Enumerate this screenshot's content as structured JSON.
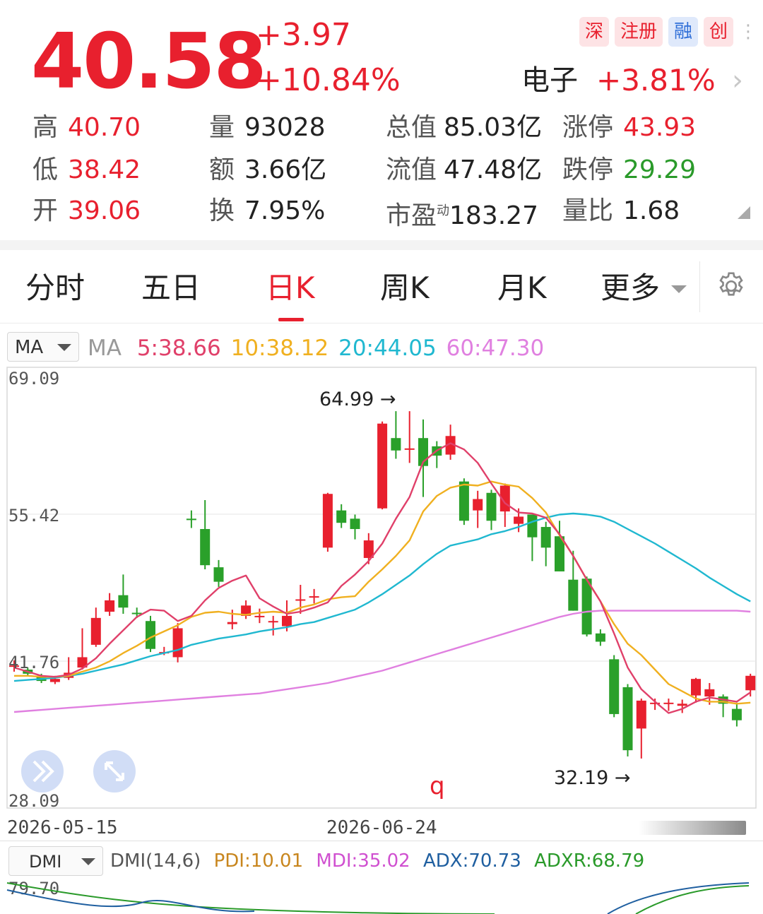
{
  "quote": {
    "price": "40.58",
    "change": "+3.97",
    "change_pct": "+10.84%",
    "badges": [
      {
        "label": "深",
        "style": "red"
      },
      {
        "label": "注册",
        "style": "red"
      },
      {
        "label": "融",
        "style": "blue"
      },
      {
        "label": "创",
        "style": "red"
      }
    ],
    "sector_name": "电子",
    "sector_change": "+3.81%",
    "stats": {
      "high": {
        "label": "高",
        "value": "40.70"
      },
      "low": {
        "label": "低",
        "value": "38.42"
      },
      "open": {
        "label": "开",
        "value": "39.06"
      },
      "volume": {
        "label": "量",
        "value": "93028"
      },
      "amount": {
        "label": "额",
        "value": "3.66亿"
      },
      "turnover": {
        "label": "换",
        "value": "7.95%"
      },
      "total_cap": {
        "label": "总值",
        "value": "85.03亿"
      },
      "float_cap": {
        "label": "流值",
        "value": "47.48亿"
      },
      "pe": {
        "label": "市盈",
        "sup": "动",
        "value": "183.27"
      },
      "limit_up": {
        "label": "涨停",
        "value": "43.93"
      },
      "limit_down": {
        "label": "跌停",
        "value": "29.29"
      },
      "volume_ratio": {
        "label": "量比",
        "value": "1.68"
      }
    }
  },
  "tabs": {
    "items": [
      "分时",
      "五日",
      "日K",
      "周K",
      "月K",
      "更多"
    ],
    "active": "日K"
  },
  "ma_legend": {
    "selector": "MA",
    "title": "MA",
    "ma5": "5:38.66",
    "ma10": "10:38.12",
    "ma20": "20:44.05",
    "ma60": "60:47.30",
    "colors": {
      "ma5": "#e0406a",
      "ma10": "#f0b020",
      "ma20": "#20b8d0",
      "ma60": "#e080e0",
      "up": "#e8202e",
      "down": "#2aa02a"
    }
  },
  "kline": {
    "y_max_label": "69.09",
    "y_mid_label": "55.42",
    "y_low_label": "41.76",
    "y_min_label": "28.09",
    "high_marker": "64.99 →",
    "low_marker": "32.19 →",
    "mark_q": "q",
    "date_left": "2026-05-15",
    "date_mid": "2026-06-24"
  },
  "chart_data": {
    "type": "candlestick",
    "y_range": [
      28.09,
      69.09
    ],
    "y_ticks": [
      69.09,
      55.42,
      41.76,
      28.09
    ],
    "x_labels": [
      {
        "index": 0,
        "label": "2026-05-15"
      },
      {
        "index": 26,
        "label": "2026-06-24"
      }
    ],
    "annotations": [
      {
        "text": "64.99 →",
        "value": 64.99
      },
      {
        "text": "32.19 →",
        "value": 32.19
      }
    ],
    "candles": [
      [
        41.1,
        41.2,
        40.6,
        41.7
      ],
      [
        40.8,
        40.4,
        40.2,
        41.0
      ],
      [
        40.2,
        39.7,
        39.5,
        40.4
      ],
      [
        39.6,
        39.9,
        39.4,
        40.2
      ],
      [
        40.0,
        40.5,
        39.8,
        42.0
      ],
      [
        41.0,
        42.0,
        40.8,
        44.8
      ],
      [
        43.2,
        45.8,
        43.0,
        46.8
      ],
      [
        46.4,
        47.5,
        46.0,
        48.2
      ],
      [
        48.0,
        46.8,
        46.2,
        50.0
      ],
      [
        46.3,
        46.2,
        45.8,
        46.8
      ],
      [
        45.5,
        42.8,
        42.5,
        46.0
      ],
      [
        42.5,
        42.5,
        42.2,
        43.0
      ],
      [
        42.0,
        44.8,
        41.5,
        45.3
      ],
      [
        55.4,
        55.3,
        54.5,
        56.2
      ],
      [
        54.4,
        50.9,
        50.5,
        57.2
      ],
      [
        50.7,
        49.3,
        48.8,
        51.4
      ],
      [
        45.2,
        45.4,
        44.7,
        46.6
      ],
      [
        46.0,
        47.0,
        45.7,
        47.5
      ],
      [
        46.0,
        46.0,
        45.3,
        46.7
      ],
      [
        45.4,
        45.5,
        44.1,
        46.0
      ],
      [
        45.0,
        46.0,
        44.5,
        47.5
      ],
      [
        47.5,
        47.6,
        46.2,
        49.0
      ],
      [
        47.8,
        47.9,
        47.2,
        48.6
      ],
      [
        52.6,
        57.8,
        52.2,
        57.9
      ],
      [
        56.2,
        55.0,
        54.5,
        56.8
      ],
      [
        55.4,
        54.4,
        53.4,
        55.8
      ],
      [
        51.6,
        53.3,
        51.0,
        54.0
      ],
      [
        56.4,
        64.6,
        56.3,
        64.8
      ],
      [
        63.2,
        62.0,
        61.2,
        65.8
      ],
      [
        62.1,
        62.2,
        60.8,
        65.8
      ],
      [
        63.2,
        60.5,
        57.5,
        65.0
      ],
      [
        62.4,
        61.5,
        60.3,
        62.9
      ],
      [
        61.6,
        63.4,
        61.1,
        64.5
      ],
      [
        59.0,
        55.2,
        54.8,
        59.3
      ],
      [
        56.2,
        57.3,
        54.5,
        58.1
      ],
      [
        57.9,
        55.2,
        54.3,
        58.2
      ],
      [
        56.1,
        58.6,
        54.6,
        58.8
      ],
      [
        54.9,
        55.6,
        54.1,
        56.4
      ],
      [
        55.8,
        53.6,
        51.3,
        55.8
      ],
      [
        54.6,
        52.6,
        50.8,
        55.1
      ],
      [
        53.7,
        50.3,
        50.3,
        55.2
      ],
      [
        49.5,
        46.5,
        46.5,
        52.3
      ],
      [
        49.6,
        44.2,
        44.0,
        49.8
      ],
      [
        44.3,
        43.5,
        43.1,
        44.7
      ],
      [
        41.8,
        36.5,
        36.2,
        42.2
      ],
      [
        39.1,
        33.0,
        32.4,
        39.4
      ],
      [
        35.1,
        37.8,
        32.2,
        38.0
      ],
      [
        37.5,
        37.6,
        36.9,
        38.0
      ],
      [
        37.5,
        37.6,
        36.8,
        38.0
      ],
      [
        37.3,
        37.5,
        36.6,
        37.9
      ],
      [
        38.3,
        39.9,
        37.6,
        40.0
      ],
      [
        38.2,
        38.9,
        37.4,
        39.5
      ],
      [
        38.2,
        37.5,
        36.2,
        38.4
      ],
      [
        37.0,
        35.9,
        35.3,
        37.6
      ],
      [
        38.8,
        40.2,
        38.2,
        40.4
      ]
    ],
    "ma5": [
      41.0,
      40.6,
      40.2,
      40.1,
      40.3,
      40.9,
      41.9,
      43.3,
      44.6,
      45.9,
      46.6,
      46.5,
      45.5,
      46.0,
      47.5,
      48.7,
      49.4,
      49.9,
      47.7,
      46.9,
      46.2,
      46.4,
      46.8,
      47.3,
      48.9,
      50.0,
      51.3,
      53.0,
      55.4,
      57.5,
      60.9,
      62.0,
      62.7,
      62.1,
      60.8,
      58.8,
      56.9,
      56.0,
      55.9,
      55.5,
      53.9,
      51.8,
      49.5,
      47.4,
      44.3,
      41.0,
      38.9,
      37.7,
      36.6,
      37.0,
      37.7,
      38.1,
      37.9,
      37.7,
      38.6
    ],
    "ma10": [
      40.2,
      40.2,
      40.1,
      40.1,
      40.2,
      40.6,
      41.0,
      41.6,
      42.4,
      43.1,
      43.9,
      44.5,
      45.1,
      45.9,
      46.3,
      46.4,
      46.2,
      46.1,
      46.3,
      46.4,
      46.3,
      46.8,
      47.1,
      47.6,
      47.8,
      47.9,
      49.3,
      50.5,
      51.8,
      53.3,
      56.1,
      57.6,
      58.4,
      58.7,
      58.6,
      59.0,
      58.7,
      58.5,
      57.4,
      56.0,
      53.8,
      51.8,
      49.5,
      47.4,
      45.2,
      43.3,
      42.2,
      40.8,
      39.4,
      38.7,
      38.0,
      37.7,
      37.7,
      37.5,
      37.6
    ],
    "ma20": [
      39.7,
      39.8,
      39.9,
      40.0,
      40.2,
      40.4,
      40.7,
      41.0,
      41.3,
      41.7,
      42.1,
      42.4,
      42.7,
      43.2,
      43.5,
      43.8,
      44.0,
      44.2,
      44.5,
      44.7,
      44.9,
      45.2,
      45.4,
      45.8,
      46.2,
      46.6,
      47.3,
      48.1,
      49.0,
      49.9,
      51.0,
      52.0,
      52.8,
      53.1,
      53.4,
      53.9,
      54.2,
      54.6,
      55.1,
      55.5,
      55.8,
      55.9,
      55.8,
      55.6,
      55.1,
      54.4,
      53.7,
      53.0,
      52.2,
      51.4,
      50.6,
      49.7,
      48.9,
      48.1,
      47.4
    ],
    "ma60": [
      36.7,
      36.8,
      36.9,
      37.0,
      37.1,
      37.2,
      37.3,
      37.4,
      37.5,
      37.6,
      37.7,
      37.8,
      37.9,
      38.0,
      38.1,
      38.2,
      38.3,
      38.4,
      38.5,
      38.7,
      38.9,
      39.1,
      39.3,
      39.5,
      39.8,
      40.1,
      40.4,
      40.7,
      41.1,
      41.5,
      41.9,
      42.3,
      42.7,
      43.1,
      43.5,
      43.9,
      44.3,
      44.7,
      45.1,
      45.5,
      45.9,
      46.2,
      46.4,
      46.5,
      46.5,
      46.5,
      46.5,
      46.5,
      46.5,
      46.5,
      46.5,
      46.5,
      46.5,
      46.5,
      46.4
    ]
  },
  "dmi": {
    "selector": "DMI",
    "title": "DMI(14,6)",
    "pdi": "PDI:10.01",
    "mdi": "MDI:35.02",
    "adx": "ADX:70.73",
    "adxr": "ADXR:68.79",
    "y_label": "79.70",
    "colors": {
      "pdi": "#c8861e",
      "mdi": "#d050d0",
      "adx": "#1f5fa0",
      "adxr": "#2a9a2a"
    }
  }
}
